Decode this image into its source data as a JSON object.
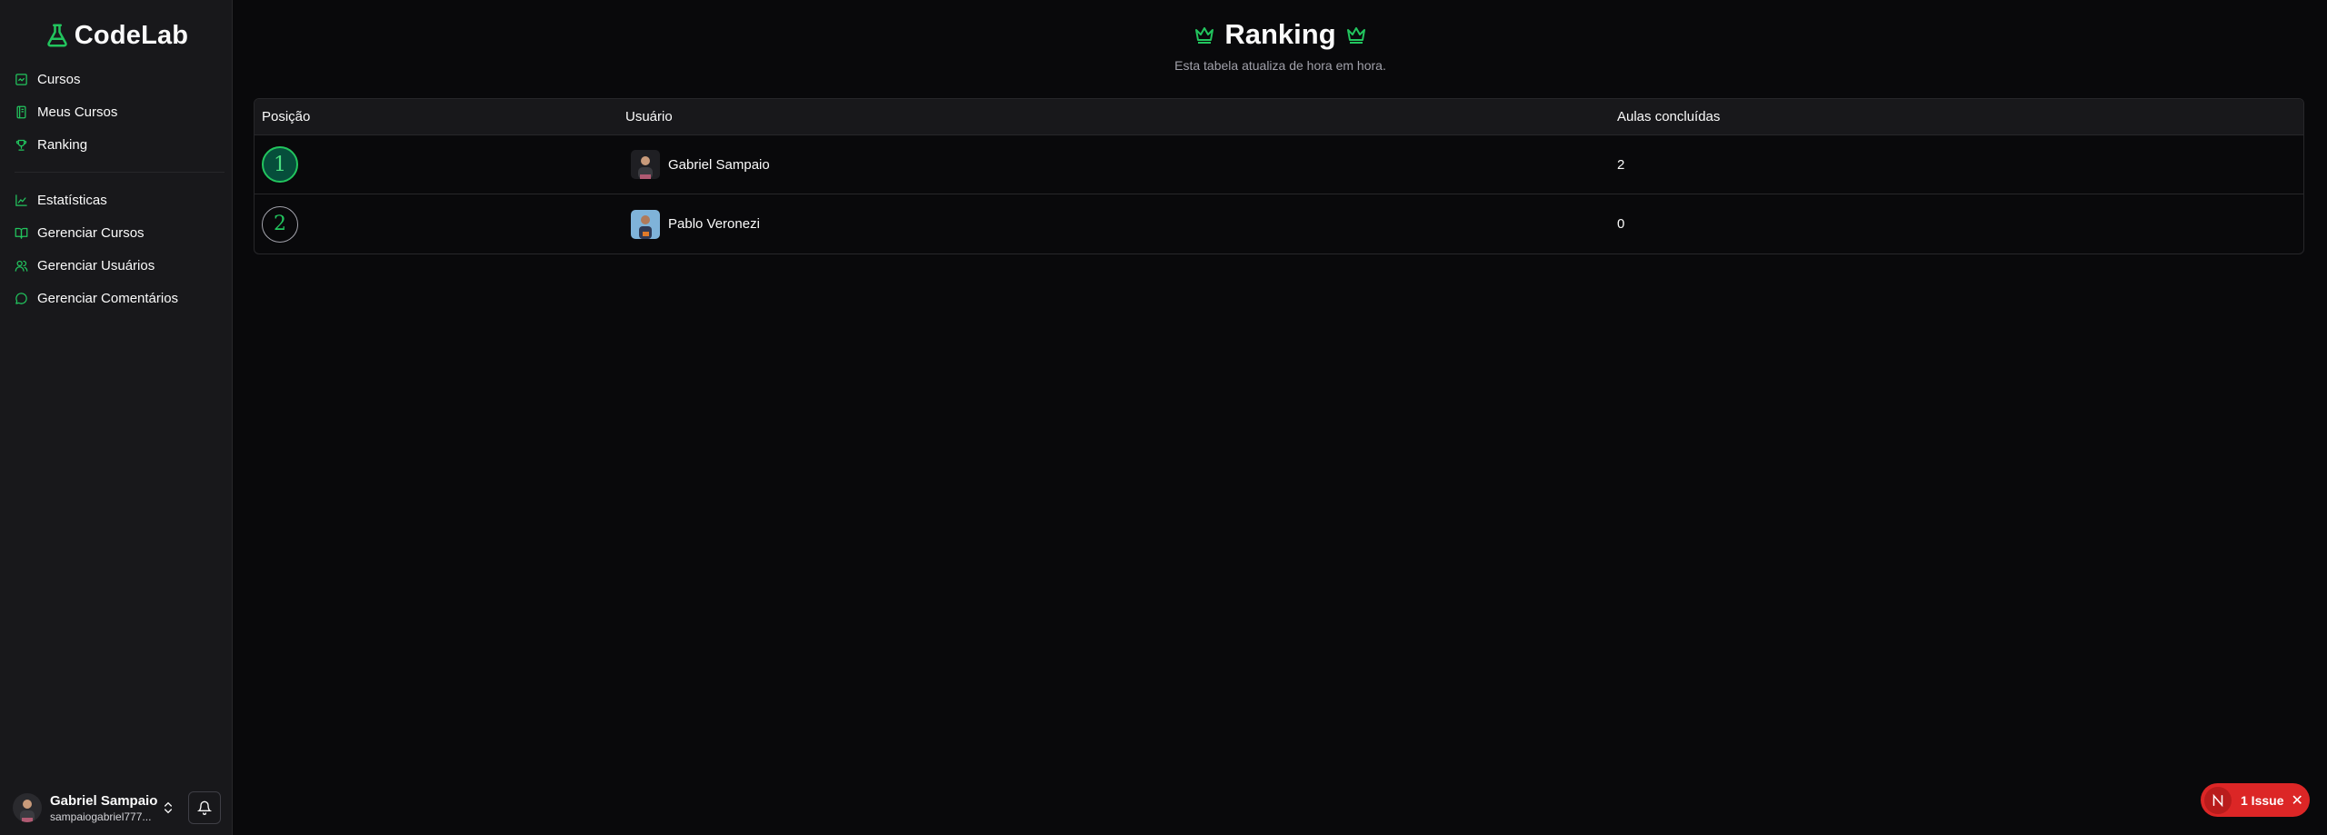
{
  "app": {
    "name": "CodeLab",
    "accent": "#22c55e"
  },
  "sidebar": {
    "items": [
      {
        "label": "Cursos",
        "icon": "chart-square-icon"
      },
      {
        "label": "Meus Cursos",
        "icon": "notebook-icon"
      },
      {
        "label": "Ranking",
        "icon": "trophy-icon"
      }
    ],
    "admin_items": [
      {
        "label": "Estatísticas",
        "icon": "bar-chart-icon"
      },
      {
        "label": "Gerenciar Cursos",
        "icon": "book-open-icon"
      },
      {
        "label": "Gerenciar Usuários",
        "icon": "users-icon"
      },
      {
        "label": "Gerenciar Comentários",
        "icon": "message-circle-icon"
      }
    ]
  },
  "user": {
    "name": "Gabriel Sampaio",
    "email": "sampaiogabriel777..."
  },
  "page": {
    "title": "Ranking",
    "subtitle": "Esta tabela atualiza de hora em hora."
  },
  "table": {
    "headers": [
      "Posição",
      "Usuário",
      "Aulas concluídas"
    ],
    "rows": [
      {
        "position": "1",
        "user": "Gabriel Sampaio",
        "lessons": "2"
      },
      {
        "position": "2",
        "user": "Pablo Veronezi",
        "lessons": "0"
      }
    ]
  },
  "issue_badge": {
    "letter": "N",
    "label": "1 Issue",
    "close": "✕",
    "color": "#dc2626"
  }
}
